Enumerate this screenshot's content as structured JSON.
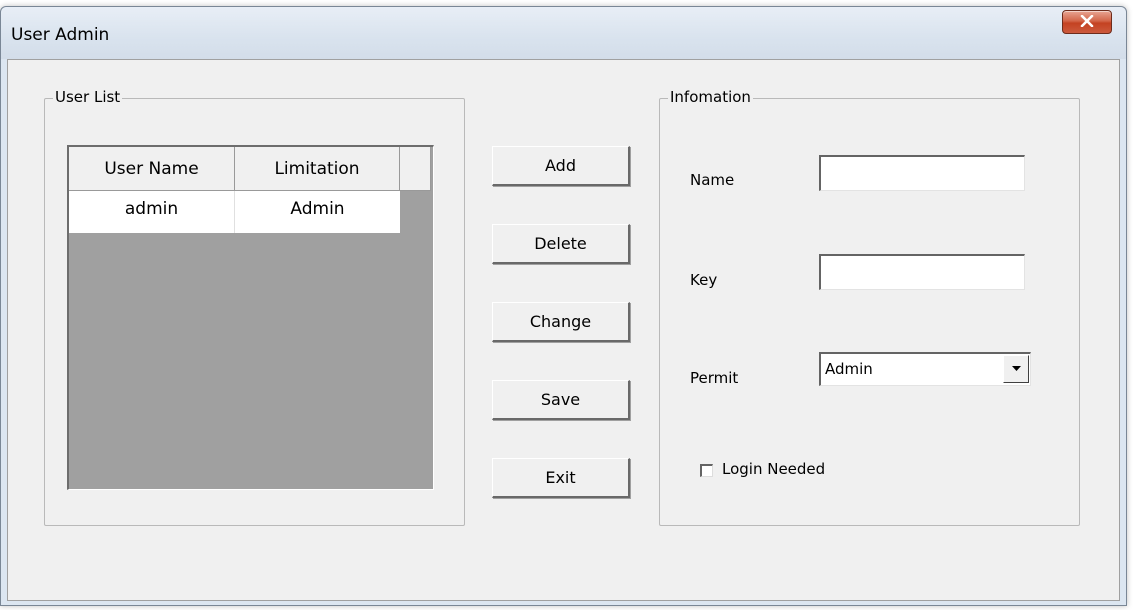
{
  "window": {
    "title": "User Admin"
  },
  "user_list": {
    "group_title": "User List",
    "columns": [
      "User Name",
      "Limitation"
    ],
    "rows": [
      [
        "admin",
        "Admin"
      ]
    ]
  },
  "buttons": {
    "add": "Add",
    "delete": "Delete",
    "change": "Change",
    "save": "Save",
    "exit": "Exit"
  },
  "info": {
    "group_title": "Infomation",
    "name_label": "Name",
    "name_value": "",
    "key_label": "Key",
    "key_value": "",
    "permit_label": "Permit",
    "permit_value": "Admin",
    "login_needed_label": "Login Needed",
    "login_needed_checked": false
  },
  "icons": {
    "close": "close-icon",
    "dropdown": "dropdown-arrow-icon"
  },
  "colors": {
    "close_button": "#c44222",
    "listview_background": "#a0a0a0",
    "dialog_background": "#f0f0f0"
  }
}
